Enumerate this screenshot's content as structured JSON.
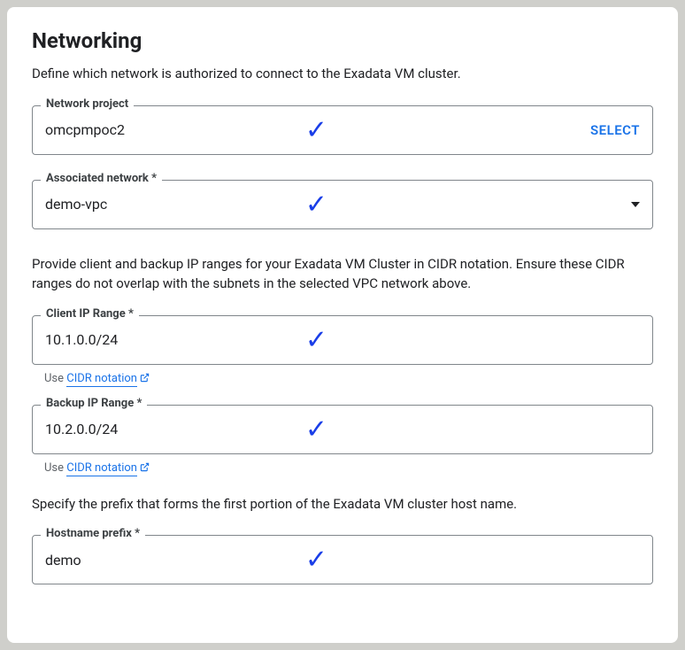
{
  "title": "Networking",
  "intro": "Define which network is authorized to connect to the Exadata VM cluster.",
  "fields": {
    "network_project": {
      "label": "Network project",
      "value": "omcpmpoc2",
      "action": "SELECT"
    },
    "associated_network": {
      "label": "Associated network *",
      "value": "demo-vpc"
    },
    "client_ip": {
      "label": "Client IP Range *",
      "value": "10.1.0.0/24",
      "hint_prefix": "Use ",
      "hint_link": "CIDR notation"
    },
    "backup_ip": {
      "label": "Backup IP Range *",
      "value": "10.2.0.0/24",
      "hint_prefix": "Use ",
      "hint_link": "CIDR notation"
    },
    "hostname_prefix": {
      "label": "Hostname prefix *",
      "value": "demo"
    }
  },
  "paragraphs": {
    "cidr_info": "Provide client and backup IP ranges for your Exadata VM Cluster in CIDR notation. Ensure these CIDR ranges do not overlap with the subnets in the selected VPC network above.",
    "hostname_info": "Specify the prefix that forms the first portion of the Exadata VM cluster host name."
  }
}
